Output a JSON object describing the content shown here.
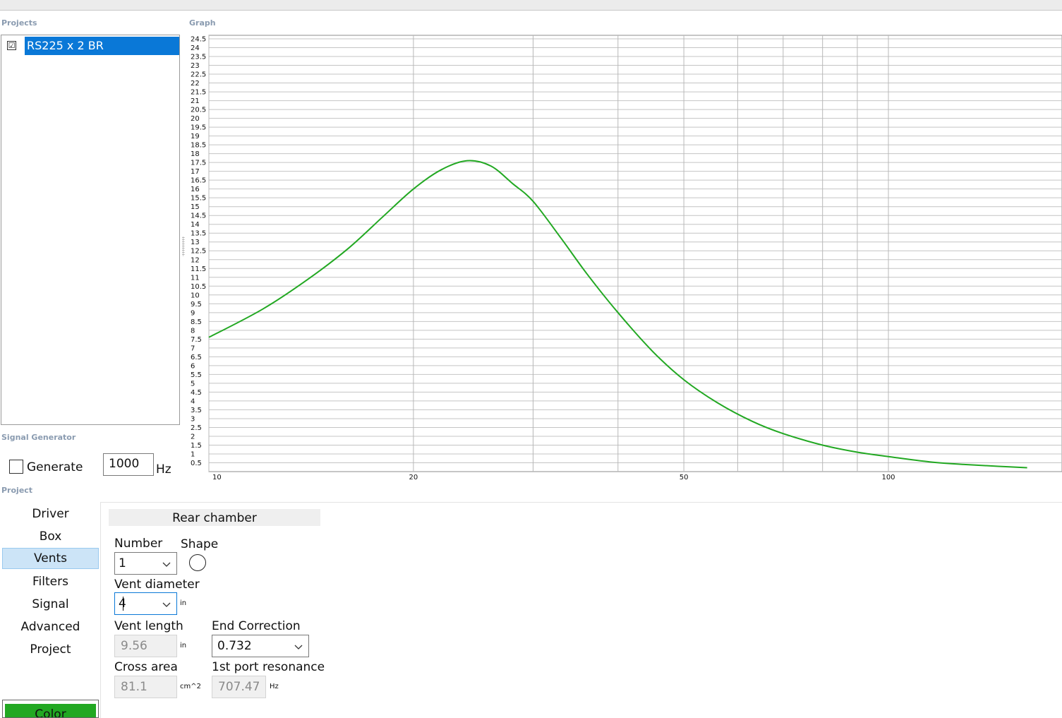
{
  "sections": {
    "projects": "Projects",
    "graph": "Graph",
    "signal_generator": "Signal Generator",
    "project": "Project"
  },
  "projects": {
    "items": [
      {
        "name": "RS225 x 2 BR",
        "checked": true,
        "checkmark": "☑"
      }
    ]
  },
  "signal_generator": {
    "generate_label": "Generate",
    "generate_checked": false,
    "frequency_value": "1000",
    "frequency_unit": "Hz"
  },
  "nav": {
    "items": [
      "Driver",
      "Box",
      "Vents",
      "Filters",
      "Signal",
      "Advanced",
      "Project"
    ],
    "active": "Vents",
    "color_button": "Color"
  },
  "vents": {
    "header": "Rear chamber",
    "number_label": "Number",
    "number_value": "1",
    "shape_label": "Shape",
    "shape_icon": "circle-shape-icon",
    "diameter_label": "Vent diameter",
    "diameter_value": "4",
    "diameter_unit": "in",
    "length_label": "Vent length",
    "length_value": "9.56",
    "length_unit": "in",
    "end_correction_label": "End Correction",
    "end_correction_value": "0.732",
    "cross_area_label": "Cross area",
    "cross_area_value": "81.1",
    "cross_area_unit": "cm^2",
    "port_resonance_label": "1st port resonance",
    "port_resonance_value": "707.47",
    "port_resonance_unit": "Hz"
  },
  "colors": {
    "curve": "#22a822",
    "selection": "#0a78d7",
    "nav_active": "#cce4f7",
    "color_swatch": "#22a822"
  },
  "chart_data": {
    "type": "line",
    "title": "",
    "xlabel": "",
    "ylabel": "",
    "x_scale": "log",
    "xlim": [
      10,
      160
    ],
    "ylim": [
      0,
      25
    ],
    "x_tick_labels": [
      "10",
      "20",
      "50",
      "100"
    ],
    "y_tick_labels": [
      "0.5",
      "1",
      "1.5",
      "2",
      "2.5",
      "3",
      "3.5",
      "4",
      "4.5",
      "5",
      "5.5",
      "6",
      "6.5",
      "7",
      "7.5",
      "8",
      "8.5",
      "9",
      "9.5",
      "10",
      "10.5",
      "11",
      "11.5",
      "12",
      "12.5",
      "13",
      "13.5",
      "14",
      "14.5",
      "15",
      "15.5",
      "16",
      "16.5",
      "17",
      "17.5",
      "18",
      "18.5",
      "19",
      "19.5",
      "20",
      "20.5",
      "21",
      "21.5",
      "22",
      "22.5",
      "23",
      "23.5",
      "24",
      "24.5"
    ],
    "grid": true,
    "series": [
      {
        "x": [
          10,
          12,
          14,
          16,
          18,
          20,
          22,
          24,
          26,
          28,
          30,
          33,
          36,
          40,
          45,
          50,
          56,
          63,
          70,
          80,
          90,
          100,
          115,
          130,
          145,
          160
        ],
        "y": [
          7.6,
          9.2,
          10.9,
          12.6,
          14.4,
          16.0,
          17.1,
          17.6,
          17.3,
          16.3,
          15.3,
          13.2,
          11.2,
          9.0,
          6.8,
          5.2,
          3.9,
          2.85,
          2.15,
          1.5,
          1.1,
          0.85,
          0.55,
          0.4,
          0.3,
          0.22
        ]
      }
    ]
  }
}
